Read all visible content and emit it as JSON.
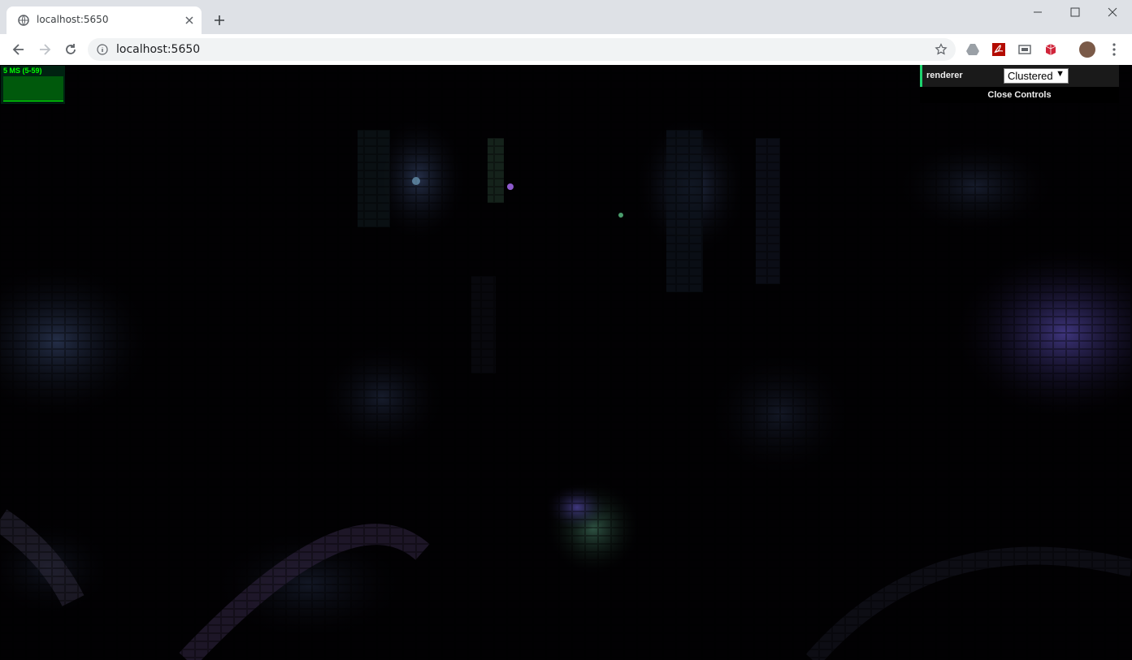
{
  "browser": {
    "tab_title": "localhost:5650",
    "url": "localhost:5650"
  },
  "stats": {
    "fps_text": "5 MS (5-59)"
  },
  "gui": {
    "renderer_label": "renderer",
    "renderer_value": "Clustered",
    "renderer_arrow": "▼",
    "close_label": "Close Controls"
  },
  "colors": {
    "stats_green": "#00ff00",
    "gui_accent": "#1ed36f",
    "scene_purple": "#5a4aa8",
    "scene_green": "#3a8a5a"
  }
}
